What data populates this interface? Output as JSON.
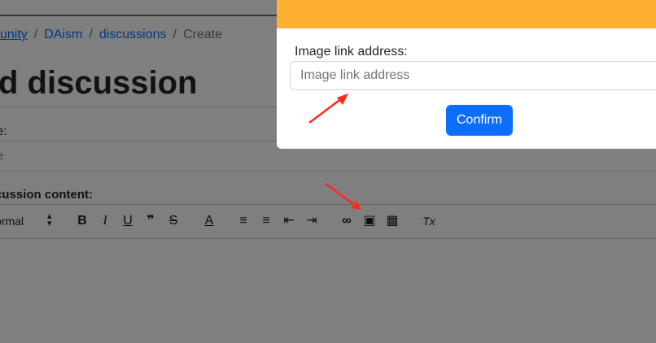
{
  "breadcrumb": {
    "items": [
      "unity",
      "DAism",
      "discussions"
    ],
    "current": "Create",
    "separator": "/"
  },
  "page_title": "d discussion",
  "form": {
    "title_label": "e:",
    "title_placeholder": "e",
    "content_label": "cussion content:"
  },
  "editor_toolbar": {
    "format_select": "ormal",
    "format_arrows": "◆",
    "buttons": [
      {
        "name": "bold",
        "glyph": "B"
      },
      {
        "name": "italic",
        "glyph": "I"
      },
      {
        "name": "underline",
        "glyph": "U"
      },
      {
        "name": "blockquote",
        "glyph": "❞"
      },
      {
        "name": "strike",
        "glyph": "S"
      },
      {
        "name": "text-color",
        "glyph": "A"
      },
      {
        "name": "ordered-list",
        "glyph": "≡"
      },
      {
        "name": "bullet-list",
        "glyph": "≡"
      },
      {
        "name": "outdent",
        "glyph": "⇤"
      },
      {
        "name": "indent",
        "glyph": "⇥"
      },
      {
        "name": "link",
        "glyph": "∞"
      },
      {
        "name": "image",
        "glyph": "▣"
      },
      {
        "name": "video",
        "glyph": "▦"
      },
      {
        "name": "clear-format",
        "glyph": "Tx"
      }
    ]
  },
  "modal": {
    "header_color": "#fdb033",
    "label": "Image link address:",
    "input_placeholder": "Image link address",
    "input_value": "",
    "confirm_label": "Confirm"
  },
  "colors": {
    "accent": "#0d6efd",
    "annotation_arrow": "#ff2a1a"
  }
}
